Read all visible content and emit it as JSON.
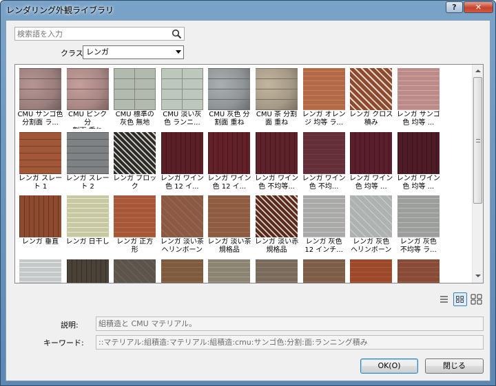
{
  "window": {
    "title": "レンダリング外観ライブラリ",
    "help_label": "?",
    "close_label": "✕"
  },
  "search": {
    "placeholder": "検索語を入力",
    "value": ""
  },
  "class_filter": {
    "label": "クラス:",
    "selected": "レンガ"
  },
  "tiles": [
    {
      "caption": "CMU サンゴ色\n分割面 ラ...",
      "color": "#9a7f7d",
      "pattern": "stone"
    },
    {
      "caption": "CMU ピンク 分\n割面 重ね",
      "color": "#a88784",
      "pattern": "stone"
    },
    {
      "caption": "CMU 標準の\n灰色 無地",
      "color": "#b2b9ad",
      "pattern": "block"
    },
    {
      "caption": "CMU 淡い灰\n色 ランニ...",
      "color": "#bcc8bc",
      "pattern": "block"
    },
    {
      "caption": "CMU 灰色 分\n割面 重ね",
      "color": "#8f9497",
      "pattern": "stone"
    },
    {
      "caption": "CMU 茶 分割\n面 重ね",
      "color": "#a59a86",
      "pattern": "stone"
    },
    {
      "caption": "レンガ オレン\nジ 均等 ラ...",
      "color": "#b06a48",
      "pattern": "brick"
    },
    {
      "caption": "レンガ クロス\n積み",
      "color": "#8c4a30",
      "pattern": "cross"
    },
    {
      "caption": "レンガ サンゴ\n色 均等 ...",
      "color": "#b98c8a",
      "pattern": "brick"
    },
    {
      "caption": "レンガ スレー\nト 1",
      "color": "#a25838",
      "pattern": "slate"
    },
    {
      "caption": "レンガ スレー\nト 2",
      "color": "#7e8284",
      "pattern": "slate"
    },
    {
      "caption": "レンガ ブロック",
      "color": "#2b2b2b",
      "pattern": "lattice"
    },
    {
      "caption": "レンガ ワイン\n色 12 イ...",
      "color": "#5b2027",
      "pattern": "vbrick"
    },
    {
      "caption": "レンガ ワイン\n色 12 イ...",
      "color": "#622028",
      "pattern": "vbrick"
    },
    {
      "caption": "レンガ ワイン\n色 不均等...",
      "color": "#5e222a",
      "pattern": "vbrick"
    },
    {
      "caption": "レンガ ワイン\n色 不均...",
      "color": "#63303a",
      "pattern": "brick"
    },
    {
      "caption": "レンガ ワイン\n色 均等 ...",
      "color": "#5b1f2c",
      "pattern": "vbrick"
    },
    {
      "caption": "レンガ ワイン\n色 均等 ...",
      "color": "#4d1c26",
      "pattern": "vbrick"
    },
    {
      "caption": "レンガ 垂直",
      "color": "#8e4a2e",
      "pattern": "vbrick"
    },
    {
      "caption": "レンガ 日干し",
      "color": "#c8c7a6",
      "pattern": "brick"
    },
    {
      "caption": "レンガ 正方\n形",
      "color": "#a5593a",
      "pattern": "brick"
    },
    {
      "caption": "レンガ 淡い茶\nヘリンボーン",
      "color": "#8a5a44",
      "pattern": "herring"
    },
    {
      "caption": "レンガ 淡い茶\n規格品",
      "color": "#8d5c42",
      "pattern": "brick"
    },
    {
      "caption": "レンガ 淡い赤\n規格品",
      "color": "#5a2a1c",
      "pattern": "lattice"
    },
    {
      "caption": "レンガ 灰色\n12 インチ...",
      "color": "#a9aaa8",
      "pattern": "brick"
    },
    {
      "caption": "レンガ 灰色\nヘリンボーン",
      "color": "#aeb2b1",
      "pattern": "herring"
    },
    {
      "caption": "レンガ 灰色\n不均等 ラ...",
      "color": "#9c9e9c",
      "pattern": "brick"
    },
    {
      "caption": "",
      "color": "#c5c8c8",
      "pattern": "brick"
    },
    {
      "caption": "",
      "color": "#4a4236",
      "pattern": "vbrick"
    },
    {
      "caption": "",
      "color": "#5c554c",
      "pattern": "herring"
    },
    {
      "caption": "",
      "color": "#7e5a3e",
      "pattern": "brick"
    },
    {
      "caption": "",
      "color": "#8a8472",
      "pattern": "brick"
    },
    {
      "caption": "",
      "color": "#7b6b5c",
      "pattern": "brick"
    },
    {
      "caption": "",
      "color": "#7c5d4a",
      "pattern": "brick"
    },
    {
      "caption": "",
      "color": "#9a4a2a",
      "pattern": "brick"
    },
    {
      "caption": "",
      "color": "#874c38",
      "pattern": "brick"
    }
  ],
  "view": {
    "list_icon": "list-view-icon",
    "medium_icon": "medium-icons-icon",
    "large_icon": "large-icons-icon"
  },
  "description": {
    "label": "説明:",
    "value": "組積造と CMU マテリアル。"
  },
  "keywords": {
    "label": "キーワード:",
    "value": "::マテリアル:組積造:マテリアル:組積造:cmu:サンゴ色:分割:面:ランニング積み"
  },
  "buttons": {
    "ok": "OK(O)",
    "close": "閉じる"
  }
}
